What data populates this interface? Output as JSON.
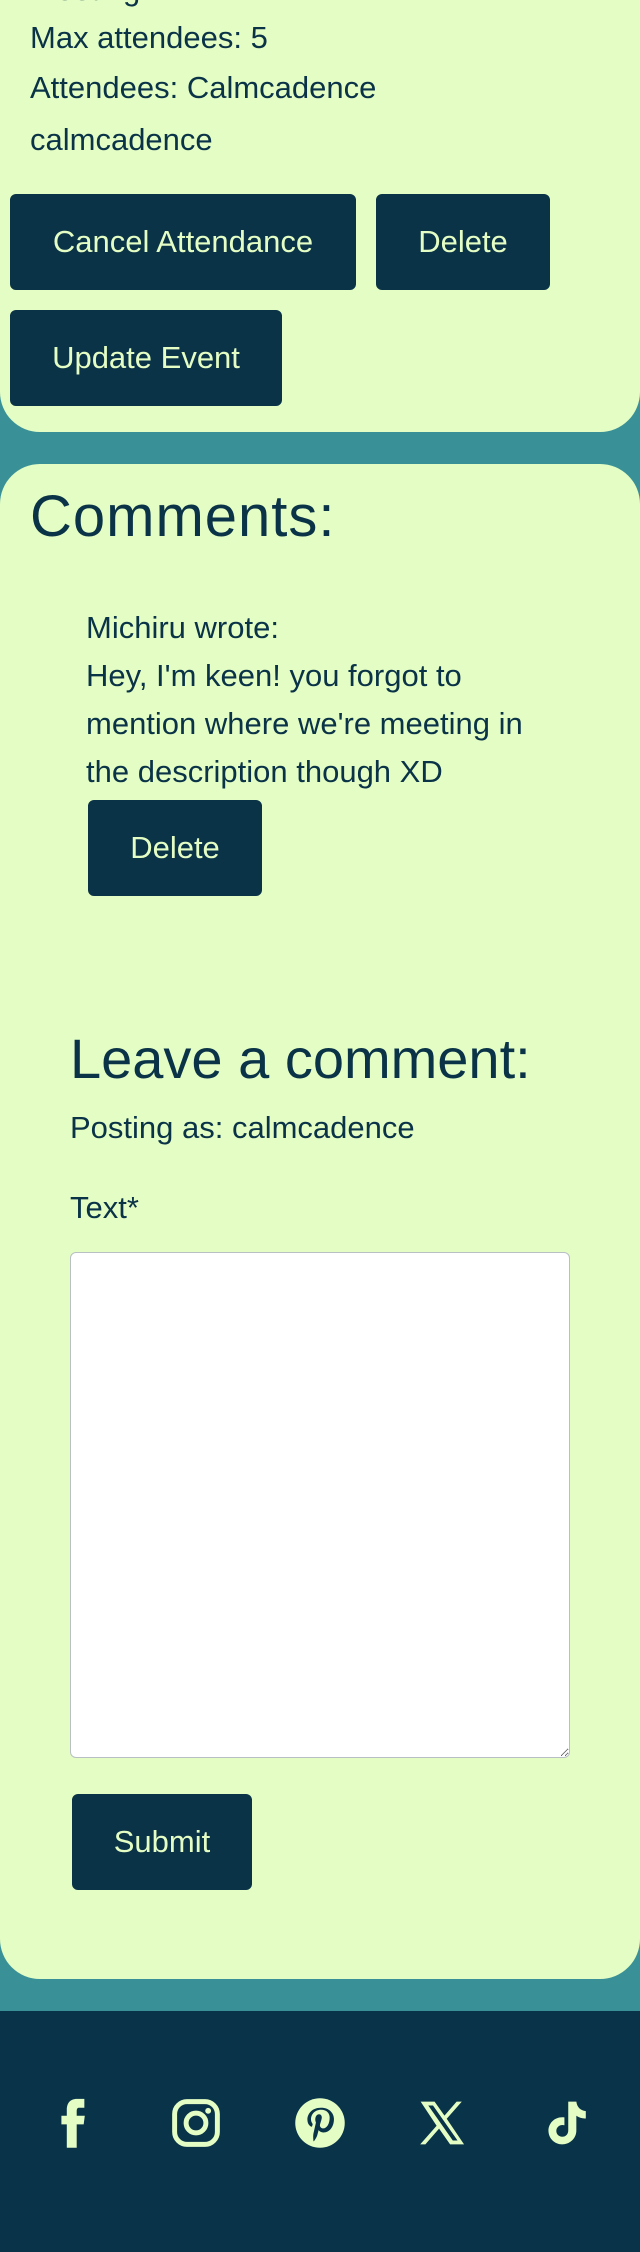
{
  "event": {
    "partial_line": "Meeting",
    "max_attendees": "Max attendees: 5",
    "attendees": "Attendees: Calmcadence",
    "attendee_name": "calmcadence",
    "cancel_label": "Cancel Attendance",
    "delete_label": "Delete",
    "update_label": "Update Event"
  },
  "comments": {
    "heading": "Comments:",
    "items": [
      {
        "author": "Michiru wrote:",
        "text": "Hey, I'm keen! you forgot to mention where we're meeting in the description though XD",
        "delete_label": "Delete"
      }
    ]
  },
  "form": {
    "heading": "Leave a comment:",
    "posting_as": "Posting as: calmcadence",
    "text_label": "Text*",
    "text_value": "",
    "submit_label": "Submit"
  },
  "footer": {
    "icons": [
      "facebook-icon",
      "instagram-icon",
      "pinterest-icon",
      "x-icon",
      "tiktok-icon"
    ]
  },
  "colors": {
    "page_background": "#399197",
    "card_background": "#e4fdc4",
    "text": "#0a3347",
    "button": "#0a3347",
    "footer": "#083348"
  }
}
